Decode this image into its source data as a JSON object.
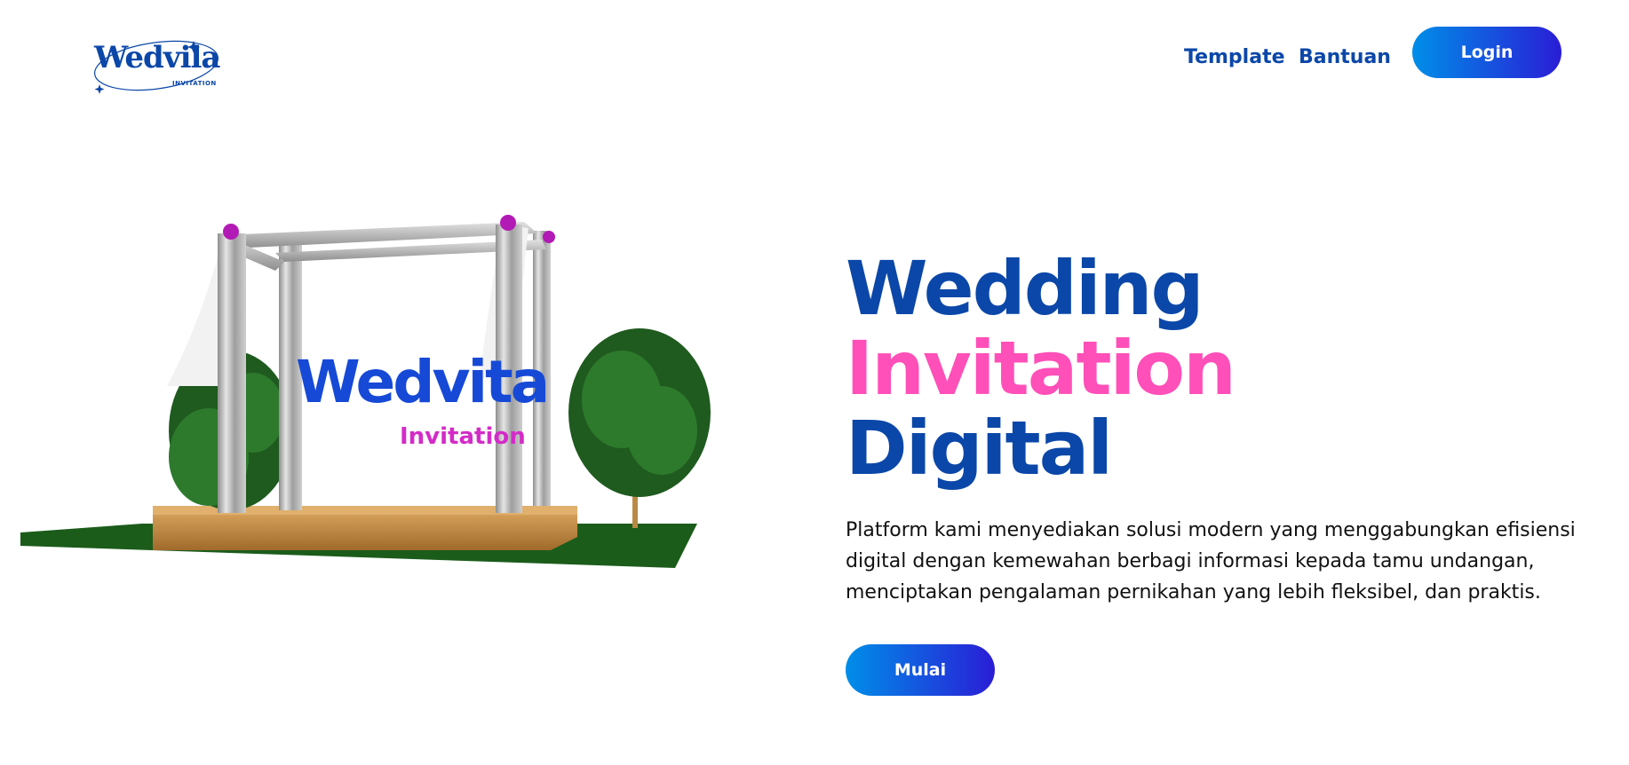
{
  "brand": {
    "name": "Wedvila",
    "tagline": "INVITATION"
  },
  "nav": {
    "template": "Template",
    "help": "Bantuan",
    "login": "Login"
  },
  "hero": {
    "title_line1": "Wedding",
    "title_line2": "Invitation",
    "title_line3": "Digital",
    "description": "Platform kami menyediakan solusi modern yang menggabungkan efisiensi digital dengan kemewahan berbagi informasi kepada tamu undangan, menciptakan pengalaman pernikahan yang lebih fleksibel, dan praktis.",
    "cta": "Mulai"
  },
  "illustration": {
    "sign_title": "Wedvita",
    "sign_subtitle": "Invitation"
  },
  "colors": {
    "primary": "#0b47a8",
    "accent": "#ff4fb8",
    "gradient_start": "#008ee8",
    "gradient_end": "#2a1dd6"
  }
}
